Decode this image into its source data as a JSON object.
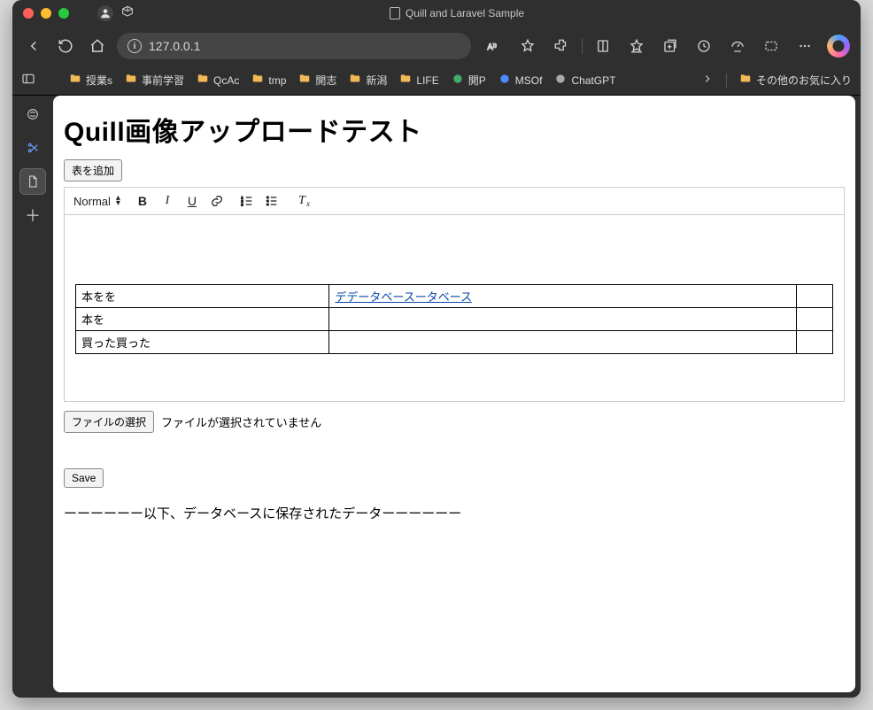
{
  "window": {
    "title": "Quill and Laravel Sample"
  },
  "address": {
    "url": "127.0.0.1"
  },
  "bookmarks": {
    "items": [
      {
        "label": "授業s"
      },
      {
        "label": "事前学習"
      },
      {
        "label": "QcAc"
      },
      {
        "label": "tmp"
      },
      {
        "label": "開志"
      },
      {
        "label": "新潟"
      },
      {
        "label": "LIFE"
      },
      {
        "label": "開P"
      },
      {
        "label": "MSOf"
      },
      {
        "label": "ChatGPT"
      }
    ],
    "overflow": "その他のお気に入り"
  },
  "page": {
    "heading": "Quill画像アップロードテスト",
    "add_table_button": "表を追加",
    "toolbar": {
      "format_label": "Normal"
    },
    "table": {
      "rows": [
        {
          "c1": "本をを",
          "c2_link": "デデータベースータベース",
          "c3": ""
        },
        {
          "c1": "本を",
          "c2": "",
          "c3": ""
        },
        {
          "c1": "買った買った",
          "c2": "",
          "c3": ""
        }
      ]
    },
    "file_button": "ファイルの選択",
    "file_status": "ファイルが選択されていません",
    "save_button": "Save",
    "divider_text": "ーーーーーー以下、データベースに保存されたデーターーーーーー"
  }
}
